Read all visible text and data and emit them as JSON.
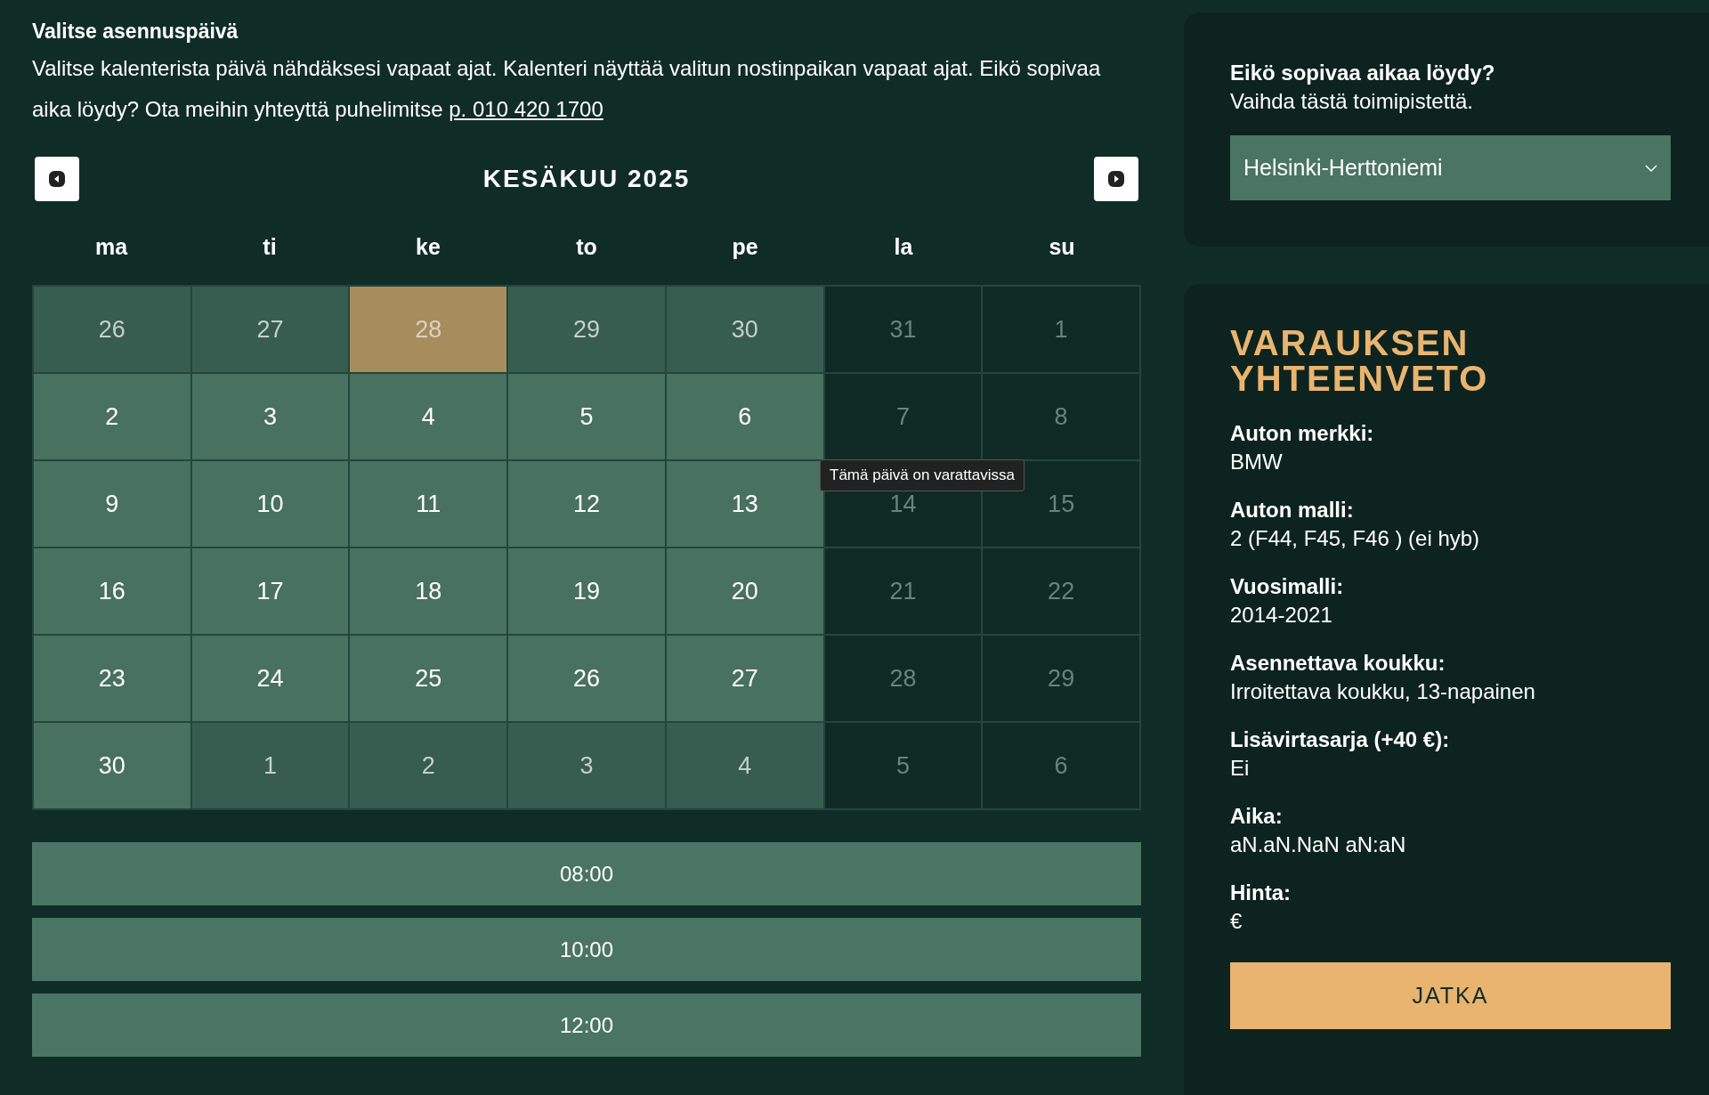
{
  "heading": "Valitse asennuspäivä",
  "intro": "Valitse kalenterista päivä nähdäksesi vapaat ajat. Kalenteri näyttää valitun nostinpaikan vapaat ajat. Eikö sopivaa aika löydy? Ota meihin yhteyttä puhelimitse",
  "phone_link": "p. 010 420 1700",
  "calendar": {
    "month": "KESÄKUU 2025",
    "weekdays": [
      "ma",
      "ti",
      "ke",
      "to",
      "pe",
      "la",
      "su"
    ],
    "days": [
      {
        "day": "26",
        "kind": "other",
        "selected": false
      },
      {
        "day": "27",
        "kind": "other",
        "selected": false
      },
      {
        "day": "28",
        "kind": "other",
        "selected": true
      },
      {
        "day": "29",
        "kind": "other",
        "selected": false
      },
      {
        "day": "30",
        "kind": "other",
        "selected": false
      },
      {
        "day": "31",
        "kind": "closed",
        "selected": false
      },
      {
        "day": "1",
        "kind": "closed",
        "selected": false
      },
      {
        "day": "2",
        "kind": "available",
        "selected": false
      },
      {
        "day": "3",
        "kind": "available",
        "selected": false
      },
      {
        "day": "4",
        "kind": "available",
        "selected": false
      },
      {
        "day": "5",
        "kind": "available",
        "selected": false
      },
      {
        "day": "6",
        "kind": "available",
        "selected": false
      },
      {
        "day": "7",
        "kind": "closed",
        "selected": false
      },
      {
        "day": "8",
        "kind": "closed",
        "selected": false
      },
      {
        "day": "9",
        "kind": "available",
        "selected": false
      },
      {
        "day": "10",
        "kind": "available",
        "selected": false
      },
      {
        "day": "11",
        "kind": "available",
        "selected": false
      },
      {
        "day": "12",
        "kind": "available",
        "selected": false
      },
      {
        "day": "13",
        "kind": "available",
        "selected": false
      },
      {
        "day": "14",
        "kind": "closed",
        "selected": false
      },
      {
        "day": "15",
        "kind": "closed",
        "selected": false
      },
      {
        "day": "16",
        "kind": "available",
        "selected": false
      },
      {
        "day": "17",
        "kind": "available",
        "selected": false
      },
      {
        "day": "18",
        "kind": "available",
        "selected": false
      },
      {
        "day": "19",
        "kind": "available",
        "selected": false
      },
      {
        "day": "20",
        "kind": "available",
        "selected": false
      },
      {
        "day": "21",
        "kind": "closed",
        "selected": false
      },
      {
        "day": "22",
        "kind": "closed",
        "selected": false
      },
      {
        "day": "23",
        "kind": "available",
        "selected": false
      },
      {
        "day": "24",
        "kind": "available",
        "selected": false
      },
      {
        "day": "25",
        "kind": "available",
        "selected": false
      },
      {
        "day": "26",
        "kind": "available",
        "selected": false
      },
      {
        "day": "27",
        "kind": "available",
        "selected": false
      },
      {
        "day": "28",
        "kind": "closed",
        "selected": false
      },
      {
        "day": "29",
        "kind": "closed",
        "selected": false
      },
      {
        "day": "30",
        "kind": "available",
        "selected": false
      },
      {
        "day": "1",
        "kind": "other",
        "selected": false
      },
      {
        "day": "2",
        "kind": "other",
        "selected": false
      },
      {
        "day": "3",
        "kind": "other",
        "selected": false
      },
      {
        "day": "4",
        "kind": "other",
        "selected": false
      },
      {
        "day": "5",
        "kind": "closed",
        "selected": false
      },
      {
        "day": "6",
        "kind": "closed",
        "selected": false
      }
    ],
    "tooltip": "Tämä päivä on varattavissa"
  },
  "time_slots": [
    "08:00",
    "10:00",
    "12:00"
  ],
  "location_panel": {
    "title": "Eikö sopivaa aikaa löydy?",
    "subtitle": "Vaihda tästä toimipistettä.",
    "select_value": "Helsinki-Herttoniemi"
  },
  "summary": {
    "title": "VARAUKSEN YHTEENVETO",
    "items": [
      {
        "label": "Auton merkki:",
        "value": "BMW"
      },
      {
        "label": "Auton malli:",
        "value": "2 (F44, F45, F46 ) (ei hyb)"
      },
      {
        "label": "Vuosimalli:",
        "value": "2014-2021"
      },
      {
        "label": "Asennettava koukku:",
        "value": "Irroitettava koukku, 13-napainen"
      },
      {
        "label": "Lisävirtasarja (+40 €):",
        "value": "Ei"
      },
      {
        "label": "Aika:",
        "value": "aN.aN.NaN aN:aN"
      },
      {
        "label": "Hinta:",
        "value": "€"
      }
    ],
    "button": "JATKA"
  }
}
